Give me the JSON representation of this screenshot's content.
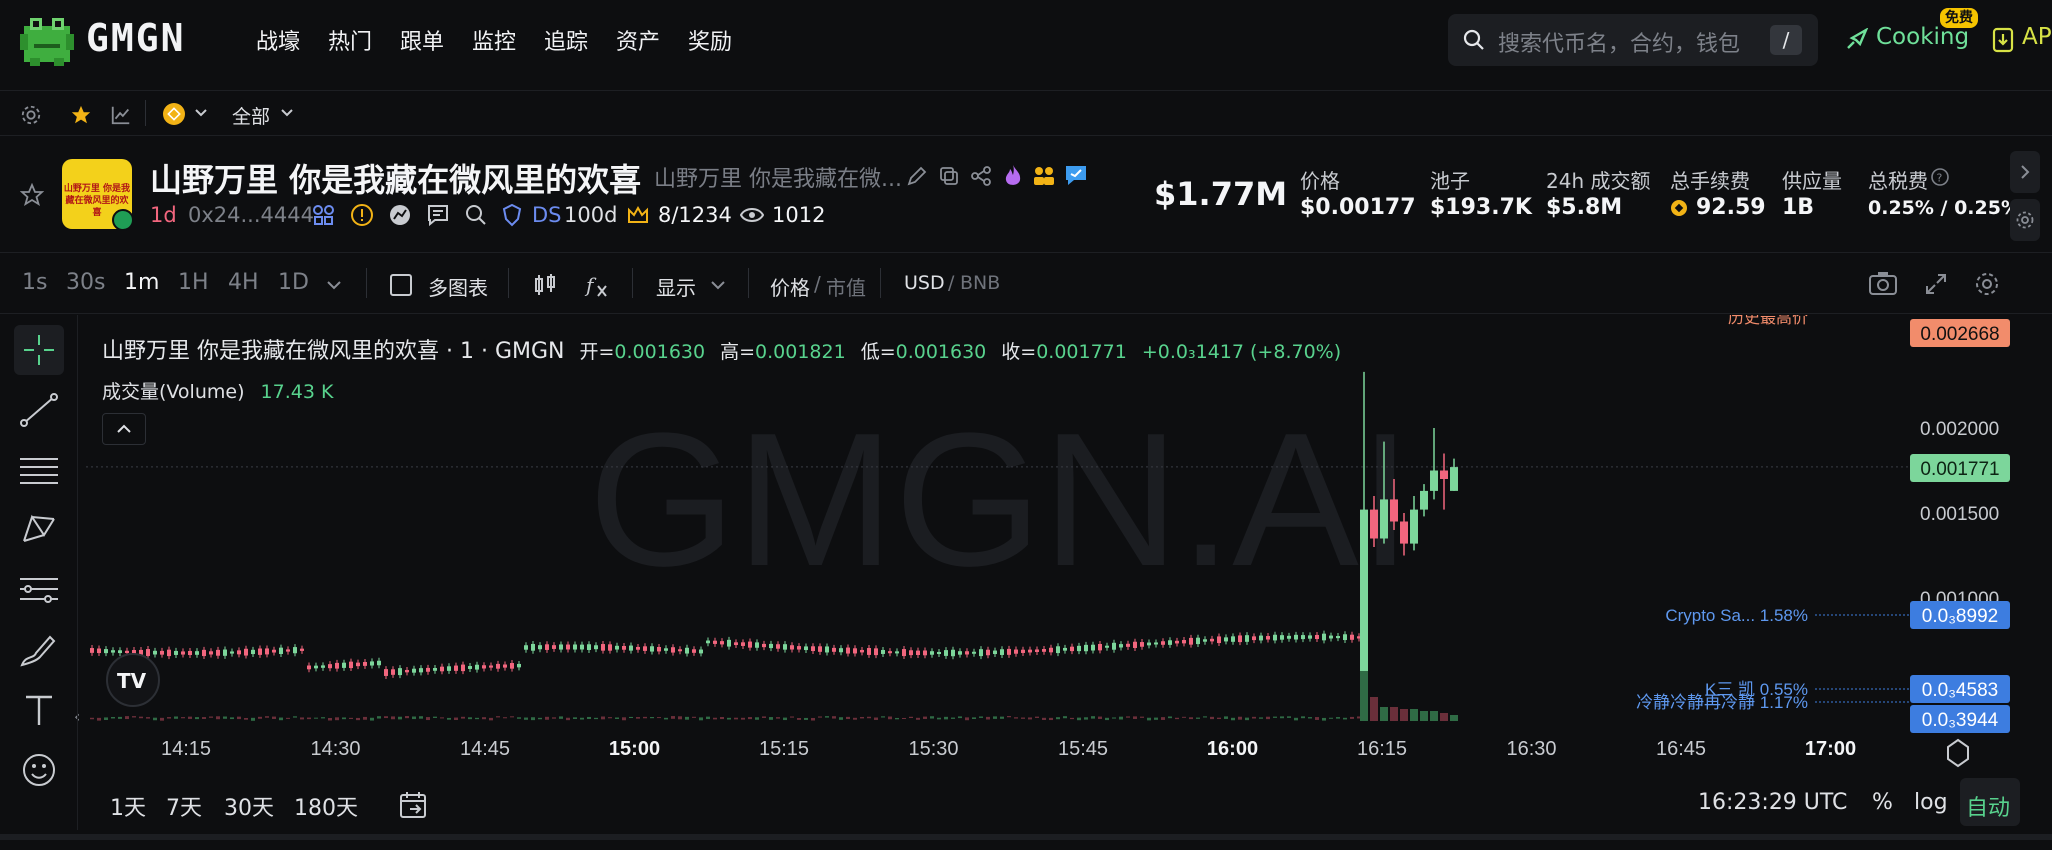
{
  "nav": {
    "logo_text": "GMGN",
    "items": [
      "战壕",
      "热门",
      "跟单",
      "监控",
      "追踪",
      "资产",
      "奖励"
    ],
    "search_placeholder": "搜索代币名，合约，钱包",
    "search_shortcut": "/",
    "cooking_label": "Cooking",
    "free_badge": "免费",
    "ap_label": "AP"
  },
  "filter": {
    "all_label": "全部"
  },
  "token": {
    "logo_text": "山野万里 你是我藏在微风里的欢喜",
    "name": "山野万里 你是我藏在微风里的欢喜",
    "subtitle": "山野万里 你是我藏在微...",
    "age": "1d",
    "address": "0x24...4444",
    "ds_label": "DS",
    "ds_value": "100d",
    "holders_rank": "8/1234",
    "views": "1012",
    "market_cap": "$1.77M",
    "stats": [
      {
        "label": "价格",
        "value": "$0.00177"
      },
      {
        "label": "池子",
        "value": "$193.7K"
      },
      {
        "label": "24h 成交额",
        "value": "$5.8M"
      },
      {
        "label": "总手续费",
        "value": "92.59"
      },
      {
        "label": "供应量",
        "value": "1B"
      },
      {
        "label": "总税费",
        "value": "0.25% / 0.25%"
      }
    ]
  },
  "toolbar": {
    "timeframes": [
      "1s",
      "30s",
      "1m",
      "1H",
      "4H",
      "1D"
    ],
    "active_timeframe": "1m",
    "multi_chart": "多图表",
    "display": "显示",
    "price_label": "价格",
    "mcap_label": "市值",
    "usd_label": "USD",
    "bnb_label": "BNB"
  },
  "legend": {
    "title": "山野万里 你是我藏在微风里的欢喜 · 1 · GMGN",
    "open_label": "开=",
    "open": "0.001630",
    "high_label": "高=",
    "high": "0.001821",
    "low_label": "低=",
    "low": "0.001630",
    "close_label": "收=",
    "close": "0.001771",
    "change": "+0.0₃1417 (+8.70%)",
    "volume_label": "成交量(Volume)",
    "volume_value": "17.43 K"
  },
  "watermark": "GMGN.AI",
  "chart_data": {
    "type": "candlestick",
    "x_ticks": [
      "14:15",
      "14:30",
      "14:45",
      "15:00",
      "15:15",
      "15:30",
      "15:45",
      "16:00",
      "16:15",
      "16:30",
      "16:45",
      "17:00"
    ],
    "bold_x_ticks": [
      "15:00",
      "16:00",
      "17:00"
    ],
    "y_ticks": [
      "0.002000",
      "0.001500",
      "0.001000"
    ],
    "price_tags": [
      {
        "label": "0.002668",
        "value": 0.002668,
        "color": "#f28c6b",
        "text_color": "#111111"
      },
      {
        "label": "0.001771",
        "value": 0.001771,
        "color": "#7cd69b",
        "text_color": "#0d2414"
      },
      {
        "label": "0.0₃8992",
        "value": 0.0008992,
        "color": "#3d7de0",
        "text_color": "#ffffff"
      },
      {
        "label": "0.0₃4583",
        "value": 0.0004583,
        "color": "#3d7de0",
        "text_color": "#ffffff"
      },
      {
        "label": "0.0₃3944",
        "value": 0.0003944,
        "color": "#3d7de0",
        "text_color": "#ffffff"
      }
    ],
    "annotations": [
      {
        "text": "Crypto Sa... 1.58%",
        "value": 0.0008992
      },
      {
        "text": "K三 凯 0.55%",
        "value": 0.0004583
      },
      {
        "text": "冷静冷静再冷静 1.17%",
        "value": 0.0003944
      }
    ],
    "ath_label": "历史最高价",
    "up_color": "#7cd69b",
    "down_color": "#f2667e"
  },
  "bottom": {
    "ranges": [
      "1天",
      "7天",
      "30天",
      "180天"
    ],
    "time": "16:23:29 UTC",
    "pct": "%",
    "log": "log",
    "auto": "自动"
  }
}
